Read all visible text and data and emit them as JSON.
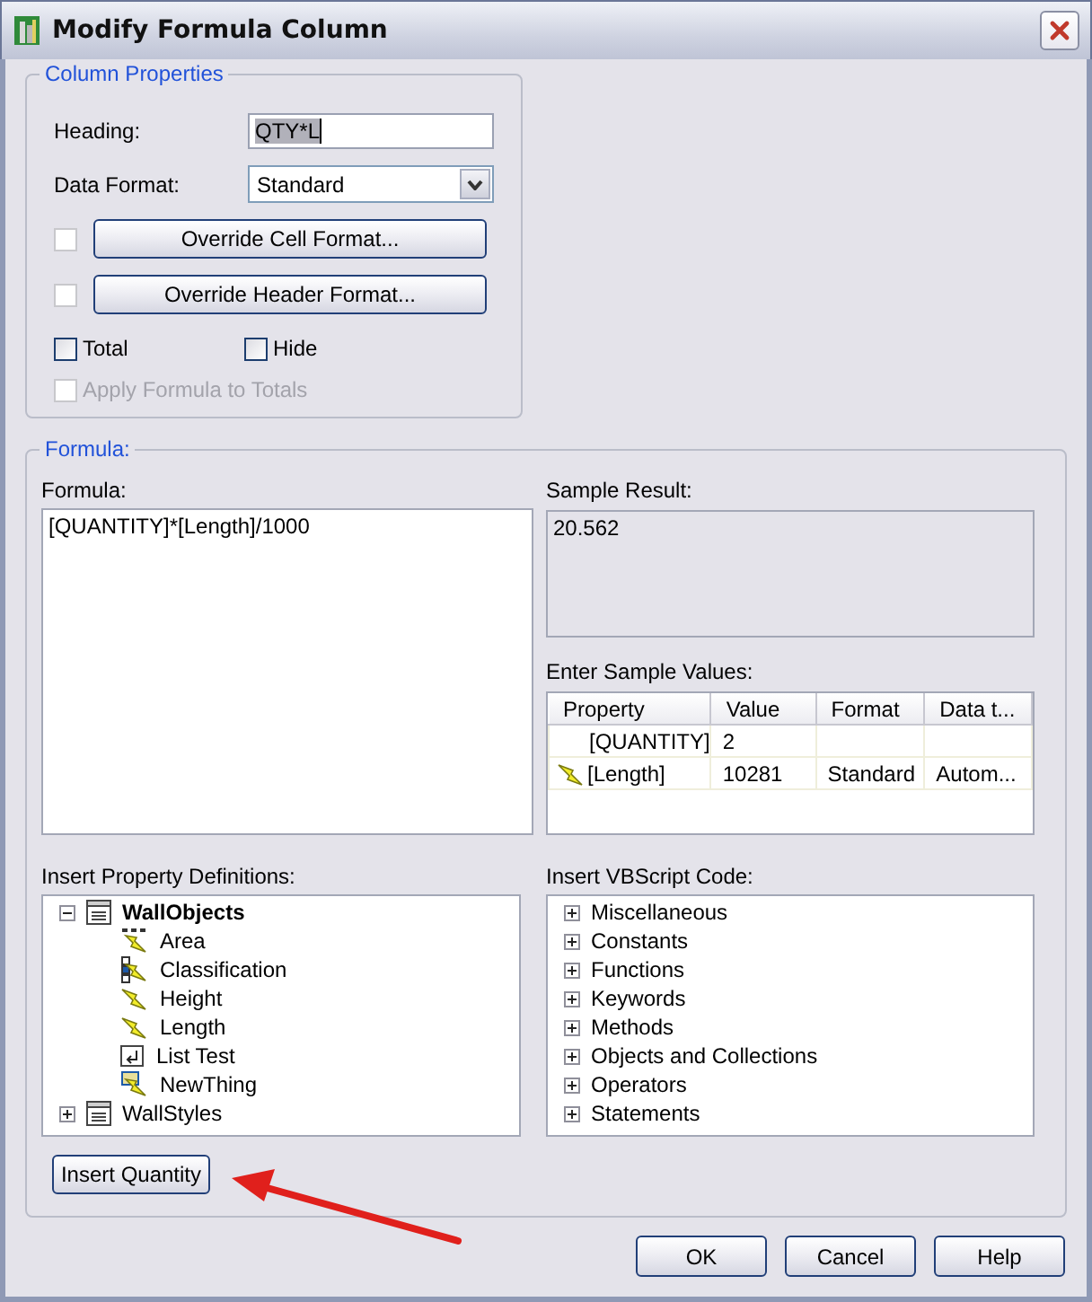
{
  "window": {
    "title": "Modify Formula Column"
  },
  "column_properties": {
    "legend": "Column Properties",
    "heading": {
      "label": "Heading:",
      "value": "QTY*L",
      "highlighted": true
    },
    "data_format": {
      "label": "Data Format:",
      "value": "Standard"
    },
    "override_rows": [
      {
        "label": "Override Cell Format...",
        "checked": false,
        "disabled": true
      },
      {
        "label": "Override Header Format...",
        "checked": false,
        "disabled": true
      }
    ],
    "checkboxes": [
      {
        "label": "Total",
        "checked": false,
        "disabled": false
      },
      {
        "label": "Hide",
        "checked": false,
        "disabled": false
      },
      {
        "label": "Apply Formula to Totals",
        "checked": false,
        "disabled": true
      }
    ]
  },
  "formula": {
    "legend": "Formula:",
    "editor": {
      "label": "Formula:",
      "value": "[QUANTITY]*[Length]/1000"
    },
    "sample_result": {
      "label": "Sample Result:",
      "value": "20.562"
    },
    "sample_values": {
      "label": "Enter Sample Values:",
      "columns": [
        "Property",
        "Value",
        "Format",
        "Data t..."
      ],
      "rows": [
        {
          "kind": "plain",
          "property": "[QUANTITY]",
          "value": "2"
        },
        {
          "kind": "automatic",
          "property": "[Length]",
          "value": "10281",
          "format": "Standard",
          "data_type": "Autom..."
        }
      ]
    },
    "property_definitions": {
      "label": "Insert Property Definitions:",
      "tree": [
        {
          "label": "WallObjects",
          "kind": "set",
          "bold": true,
          "expanded": true,
          "children": [
            {
              "label": "Area",
              "kind": "formula"
            },
            {
              "label": "Classification",
              "kind": "classification"
            },
            {
              "label": "Height",
              "kind": "automatic"
            },
            {
              "label": "Length",
              "kind": "automatic"
            },
            {
              "label": "List Test",
              "kind": "list"
            },
            {
              "label": "NewThing",
              "kind": "location"
            }
          ]
        },
        {
          "label": "WallStyles",
          "kind": "set",
          "bold": false,
          "expanded": false
        }
      ]
    },
    "vbscript": {
      "label": "Insert VBScript Code:",
      "items": [
        {
          "label": "Miscellaneous",
          "expanded": false
        },
        {
          "label": "Constants",
          "expanded": false
        },
        {
          "label": "Functions",
          "expanded": false
        },
        {
          "label": "Keywords",
          "expanded": false
        },
        {
          "label": "Methods",
          "expanded": false
        },
        {
          "label": "Objects and Collections",
          "expanded": false
        },
        {
          "label": "Operators",
          "expanded": false
        },
        {
          "label": "Statements",
          "expanded": false
        }
      ]
    },
    "insert_button": "Insert Quantity"
  },
  "buttons": [
    "OK",
    "Cancel",
    "Help"
  ]
}
